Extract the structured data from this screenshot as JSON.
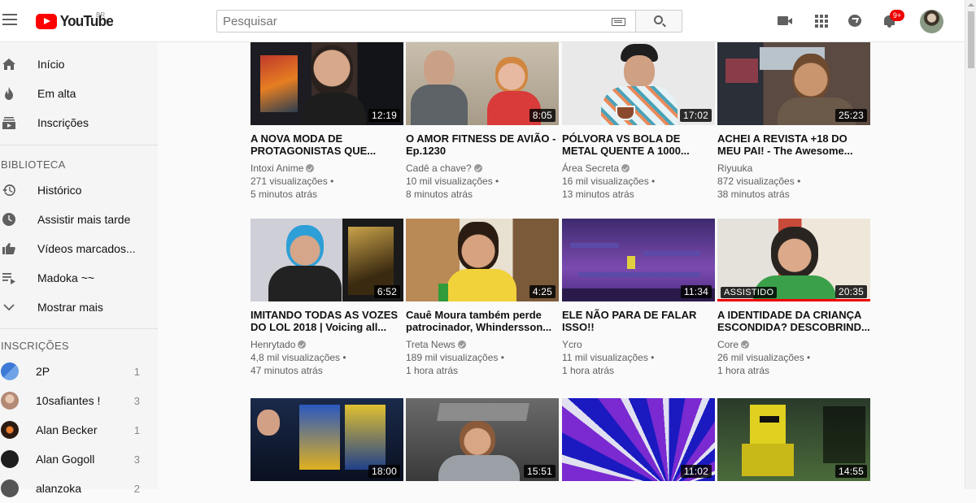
{
  "header": {
    "logo_text": "YouTube",
    "logo_region": "BR",
    "search_placeholder": "Pesquisar",
    "notifications_badge": "9+"
  },
  "sidebar": {
    "main_items": [
      {
        "label": "Início",
        "icon": "home-icon"
      },
      {
        "label": "Em alta",
        "icon": "flame-icon"
      },
      {
        "label": "Inscrições",
        "icon": "subscriptions-icon"
      }
    ],
    "library_title": "BIBLIOTECA",
    "library_items": [
      {
        "label": "Histórico",
        "icon": "history-icon"
      },
      {
        "label": "Assistir mais tarde",
        "icon": "clock-icon"
      },
      {
        "label": "Vídeos marcados...",
        "icon": "thumbs-up-icon"
      },
      {
        "label": "Madoka ~~",
        "icon": "playlist-icon"
      },
      {
        "label": "Mostrar mais",
        "icon": "chevron-down-icon"
      }
    ],
    "subscriptions_title": "INSCRIÇÕES",
    "subscriptions": [
      {
        "label": "2P",
        "count": "1"
      },
      {
        "label": "10safiantes !",
        "count": "3"
      },
      {
        "label": "Alan Becker",
        "count": "1"
      },
      {
        "label": "Alan Gogoll",
        "count": "3"
      },
      {
        "label": "alanzoka",
        "count": "2"
      }
    ]
  },
  "videos": [
    {
      "title1": "A NOVA MODA DE",
      "title2": "PROTAGONISTAS QUE...",
      "channel": "Intoxi Anime",
      "views": "271 visualizações",
      "age": "5 minutos atrás",
      "duration": "12:19"
    },
    {
      "title1": "O AMOR FITNESS DE AVIÃO -",
      "title2": "Ep.1230",
      "channel": "Cadê a chave?",
      "views": "10 mil visualizações",
      "age": "8 minutos atrás",
      "duration": "8:05"
    },
    {
      "title1": "PÓLVORA VS BOLA DE",
      "title2": "METAL QUENTE A 1000...",
      "channel": "Área Secreta",
      "views": "16 mil visualizações",
      "age": "13 minutos atrás",
      "duration": "17:02"
    },
    {
      "title1": "ACHEI A REVISTA +18 DO",
      "title2": "MEU PAI! - The Awesome...",
      "channel": "Riyuuka",
      "views": "872 visualizações",
      "age": "38 minutos atrás",
      "duration": "25:23"
    },
    {
      "title1": "IMITANDO TODAS AS VOZES",
      "title2": "DO LOL 2018 | Voicing all...",
      "channel": "Henrytado",
      "views": "4,8 mil visualizações",
      "age": "47 minutos atrás",
      "duration": "6:52"
    },
    {
      "title1": "Cauê Moura também perde",
      "title2": "patrocinador, Whindersson...",
      "channel": "Treta News",
      "views": "189 mil visualizações",
      "age": "1 hora atrás",
      "duration": "4:25"
    },
    {
      "title1": "ELE NÃO PARA DE FALAR",
      "title2": "ISSO!!",
      "channel": "Ycro",
      "views": "11 mil visualizações",
      "age": "1 hora atrás",
      "duration": "11:34"
    },
    {
      "title1": "A IDENTIDADE DA CRIANÇA",
      "title2": "ESCONDIDA? DESCOBRIND...",
      "channel": "Core",
      "views": "26 mil visualizações",
      "age": "1 hora atrás",
      "duration": "20:35",
      "watched_label": "ASSISTIDO"
    },
    {
      "duration": "18:00"
    },
    {
      "duration": "15:51"
    },
    {
      "duration": "11:02"
    },
    {
      "duration": "14:55"
    }
  ]
}
